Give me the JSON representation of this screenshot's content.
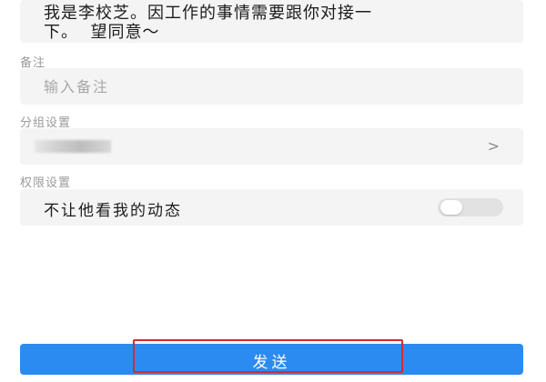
{
  "verification": {
    "message": "我是李校芝。因工作的事情需要跟你对接一\n下。  望同意～"
  },
  "remark": {
    "section_label": "备注",
    "placeholder": "输入备注",
    "value": ""
  },
  "group": {
    "section_label": "分组设置",
    "chevron": ">"
  },
  "permission": {
    "section_label": "权限设置",
    "hide_moments_label": "不让他看我的动态",
    "hide_moments_enabled": false
  },
  "send": {
    "label": "发送"
  },
  "colors": {
    "accent": "#2c8bf0",
    "highlight": "#d62b2b",
    "field_bg": "#f4f4f4"
  }
}
